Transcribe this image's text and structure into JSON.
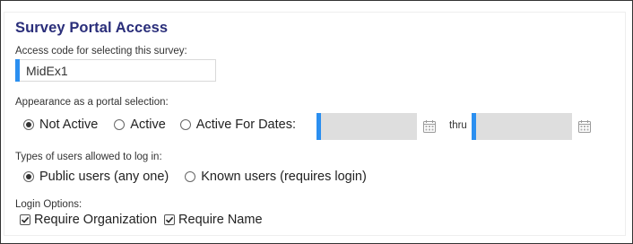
{
  "section_title": "Survey Portal Access",
  "access_code": {
    "label": "Access code for selecting this survey:",
    "value": "MidEx1"
  },
  "appearance": {
    "label": "Appearance as a portal selection:",
    "options": [
      "Not Active",
      "Active",
      "Active For Dates:"
    ],
    "selected": "Not Active",
    "thru_label": "thru",
    "start_date": "",
    "end_date": ""
  },
  "user_types": {
    "label": "Types of users allowed to log in:",
    "options": [
      "Public users (any one)",
      "Known users (requires login)"
    ],
    "selected": "Public users (any one)"
  },
  "login_options": {
    "label": "Login Options:",
    "items": [
      {
        "label": "Require Organization",
        "checked": true
      },
      {
        "label": "Require Name",
        "checked": true
      }
    ]
  },
  "colors": {
    "title": "#2a2e7a",
    "accent": "#2b8ff0",
    "disabled_field": "#dedede"
  },
  "icons": {
    "date_picker": "calendar-icon"
  }
}
